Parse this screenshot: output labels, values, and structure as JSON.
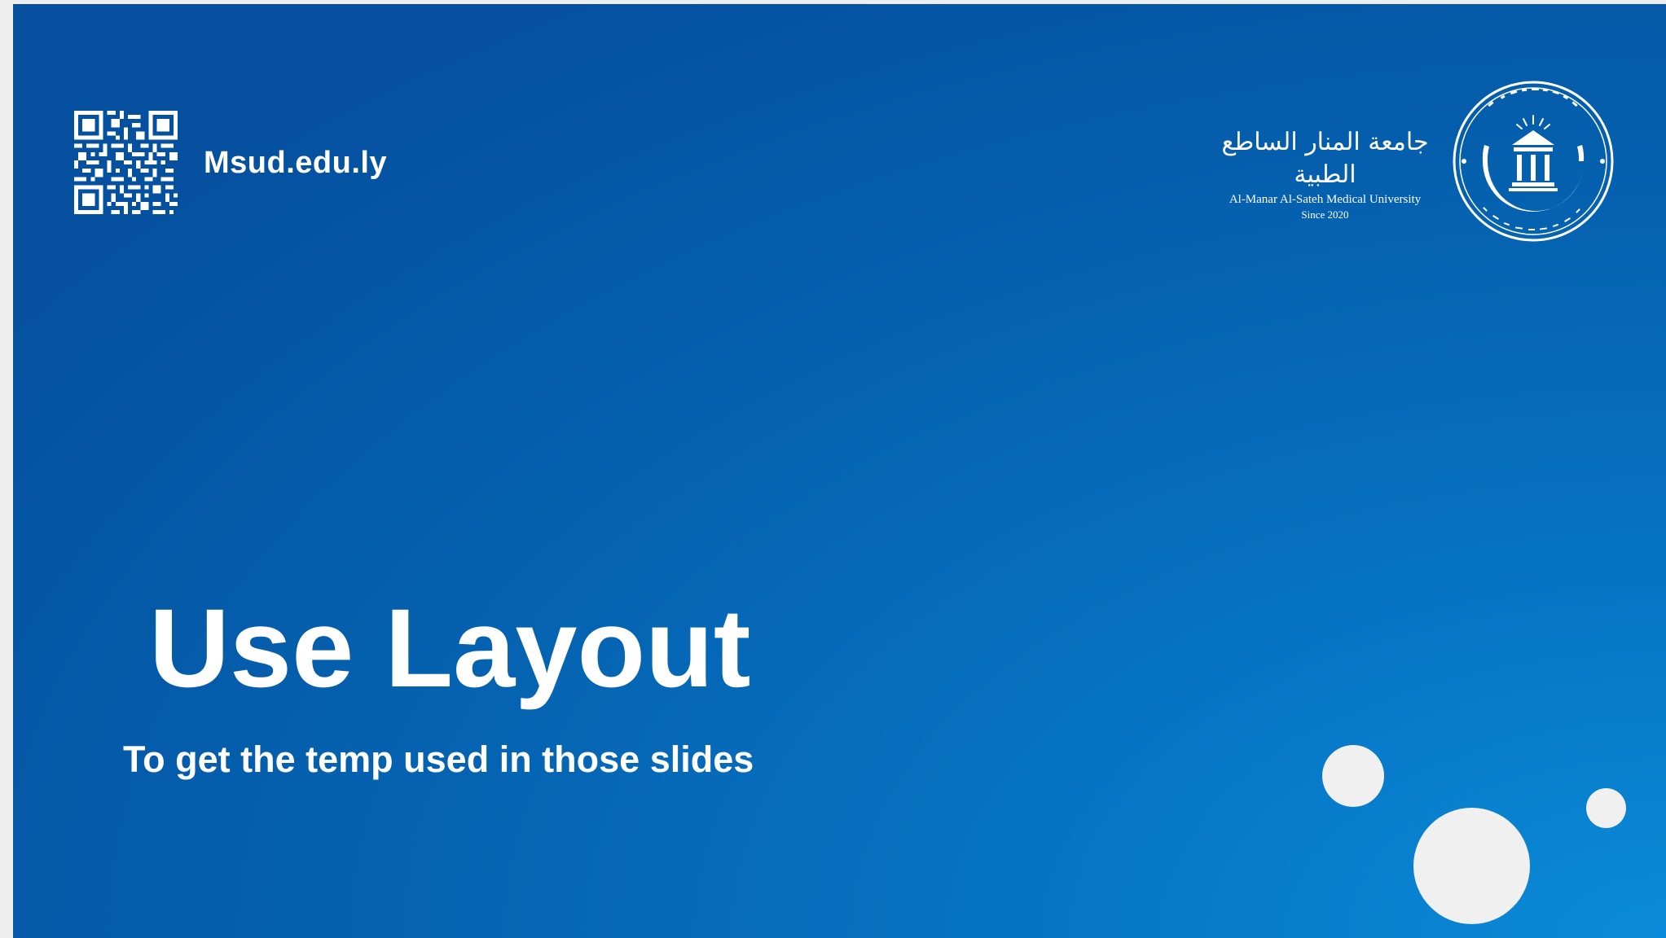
{
  "header": {
    "website": "Msud.edu.ly",
    "qr_code_icon": "qr-code-icon"
  },
  "logo": {
    "arabic_name": "جامعة المنار الساطع الطبية",
    "english_name": "Al-Manar Al-Sateh Medical University",
    "since": "Since 2020",
    "seal_icon": "university-seal-icon"
  },
  "main": {
    "title": "Use Layout",
    "subtitle": "To get the temp used in those slides"
  },
  "colors": {
    "background_dark": "#0551a0",
    "background_light": "#0a8bd8",
    "text": "#ffffff",
    "bubble": "#f0f0f0"
  }
}
